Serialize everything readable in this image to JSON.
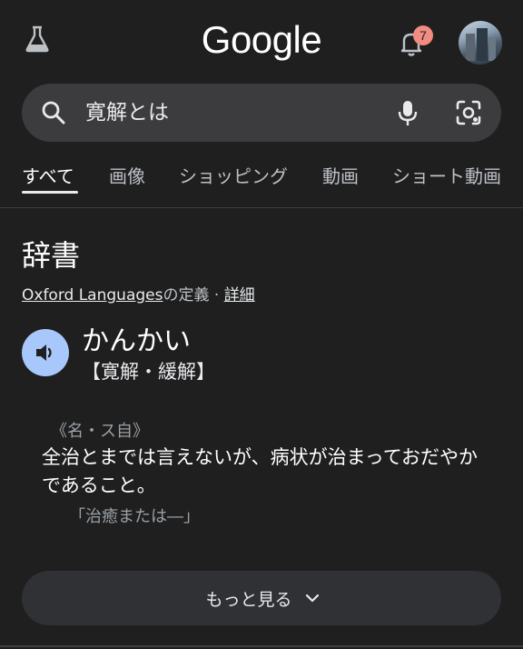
{
  "header": {
    "logo_text": "Google",
    "notification_count": "7",
    "labs_icon": "flask-icon",
    "bell_icon": "bell-icon",
    "avatar": "profile-avatar"
  },
  "search": {
    "query": "寛解とは",
    "search_icon": "search-icon",
    "mic_icon": "mic-icon",
    "lens_icon": "camera-lens-icon"
  },
  "tabs": [
    {
      "label": "すべて",
      "active": true
    },
    {
      "label": "画像"
    },
    {
      "label": "ショッピング"
    },
    {
      "label": "動画"
    },
    {
      "label": "ショート動画"
    }
  ],
  "dictionary": {
    "title": "辞書",
    "source_link": "Oxford Languages",
    "source_suffix": "の定義 · ",
    "details_link": "詳細",
    "word": "かんかい",
    "kanji": "【寛解・緩解】",
    "part_of_speech": "《名・ス自》",
    "definition": "全治とまでは言えないが、病状が治まっておだやかであること。",
    "example": "「治癒または―」",
    "speaker_icon": "speaker-icon"
  },
  "more_button": {
    "label": "もっと見る",
    "icon": "chevron-down-icon"
  },
  "colors": {
    "background": "#1f1f1f",
    "searchbox": "#3c3c3e",
    "badge": "#f28b82",
    "speaker": "#a8c7fa",
    "button": "#303134"
  }
}
